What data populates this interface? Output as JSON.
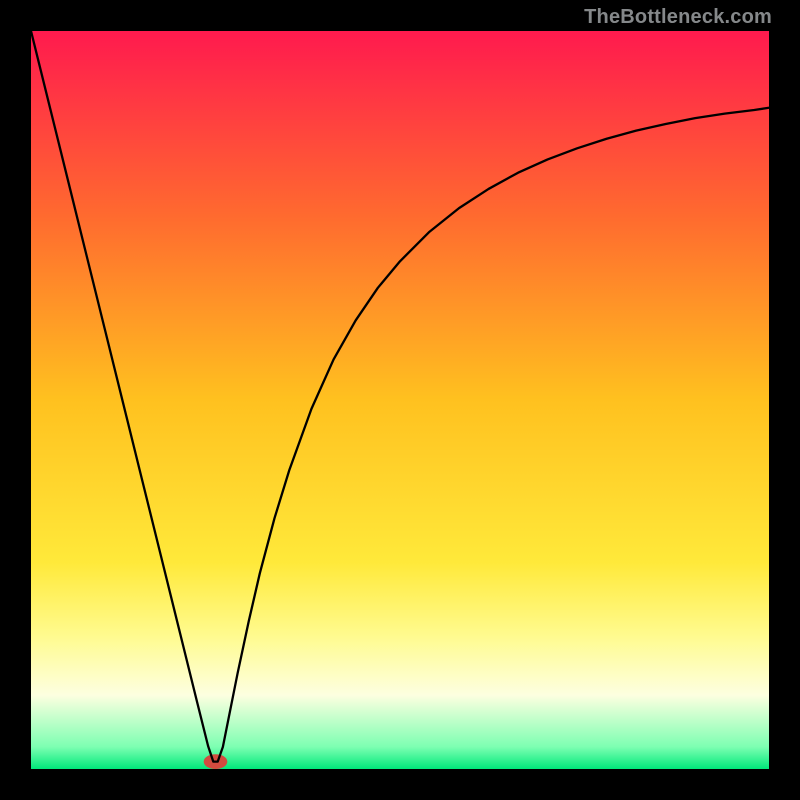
{
  "watermark": "TheBottleneck.com",
  "chart_data": {
    "type": "line",
    "title": "",
    "xlabel": "",
    "ylabel": "",
    "xlim": [
      0,
      100
    ],
    "ylim": [
      0,
      100
    ],
    "background_gradient": {
      "stops": [
        {
          "offset": 0.0,
          "color": "#ff1a4e"
        },
        {
          "offset": 0.25,
          "color": "#ff6a2f"
        },
        {
          "offset": 0.5,
          "color": "#ffc11f"
        },
        {
          "offset": 0.72,
          "color": "#ffe93a"
        },
        {
          "offset": 0.82,
          "color": "#fffb8f"
        },
        {
          "offset": 0.9,
          "color": "#fdffe0"
        },
        {
          "offset": 0.97,
          "color": "#7dffb2"
        },
        {
          "offset": 1.0,
          "color": "#00e87a"
        }
      ]
    },
    "marker": {
      "x": 25,
      "y": 1,
      "color": "#d24b3f",
      "rx": 1.6,
      "ry": 1.0
    },
    "series": [
      {
        "name": "curve",
        "stroke": "#000000",
        "stroke_width": 2.3,
        "x": [
          0.0,
          2.5,
          5.0,
          7.5,
          10.0,
          12.5,
          15.0,
          17.5,
          20.0,
          22.5,
          23.5,
          24.0,
          24.7,
          25.3,
          26.0,
          27.0,
          28.0,
          29.5,
          31.0,
          33.0,
          35.0,
          38.0,
          41.0,
          44.0,
          47.0,
          50.0,
          54.0,
          58.0,
          62.0,
          66.0,
          70.0,
          74.0,
          78.0,
          82.0,
          86.0,
          90.0,
          94.0,
          98.0,
          100.0
        ],
        "values": [
          100.0,
          89.9,
          79.8,
          69.7,
          59.6,
          49.5,
          39.4,
          29.3,
          19.2,
          9.1,
          5.1,
          3.1,
          1.0,
          1.0,
          3.0,
          8.0,
          13.0,
          20.0,
          26.5,
          34.0,
          40.5,
          48.8,
          55.5,
          60.8,
          65.2,
          68.8,
          72.8,
          76.0,
          78.6,
          80.8,
          82.6,
          84.1,
          85.4,
          86.5,
          87.4,
          88.2,
          88.8,
          89.3,
          89.6
        ]
      }
    ]
  }
}
